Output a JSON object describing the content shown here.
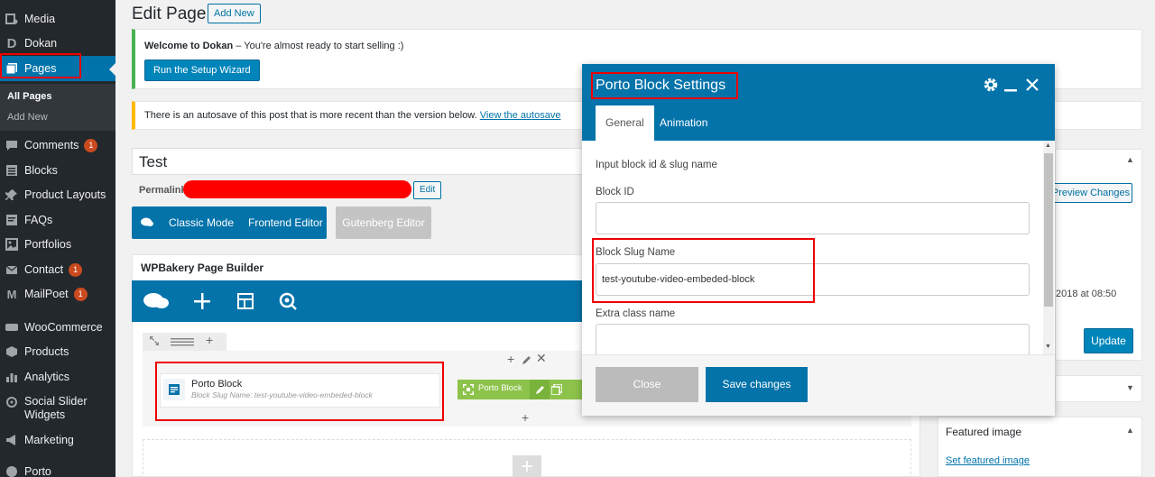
{
  "sidebar": {
    "items": [
      {
        "label": "Media",
        "icon": "media-icon",
        "badge": ""
      },
      {
        "label": "Dokan",
        "icon": "dokan-icon",
        "badge": ""
      },
      {
        "label": "Pages",
        "icon": "pages-icon",
        "badge": ""
      },
      {
        "label": "Comments",
        "icon": "comments-icon",
        "badge": "1"
      },
      {
        "label": "Blocks",
        "icon": "blocks-icon",
        "badge": ""
      },
      {
        "label": "Product Layouts",
        "icon": "pin-icon",
        "badge": ""
      },
      {
        "label": "FAQs",
        "icon": "faqs-icon",
        "badge": ""
      },
      {
        "label": "Portfolios",
        "icon": "portfolio-icon",
        "badge": ""
      },
      {
        "label": "Contact",
        "icon": "mail-icon",
        "badge": "1"
      },
      {
        "label": "MailPoet",
        "icon": "mailpoet-icon",
        "badge": "1"
      },
      {
        "label": "WooCommerce",
        "icon": "woo-icon",
        "badge": ""
      },
      {
        "label": "Products",
        "icon": "products-icon",
        "badge": ""
      },
      {
        "label": "Analytics",
        "icon": "analytics-icon",
        "badge": ""
      },
      {
        "label": "Social Slider",
        "label2": "Widgets",
        "icon": "social-icon",
        "badge": ""
      },
      {
        "label": "Marketing",
        "icon": "marketing-icon",
        "badge": ""
      },
      {
        "label": "Porto",
        "icon": "porto-icon",
        "badge": ""
      }
    ],
    "submenu": [
      "All Pages",
      "Add New"
    ]
  },
  "header": {
    "title": "Edit Page",
    "add_new": "Add New"
  },
  "notices": {
    "welcome_bold": "Welcome to Dokan",
    "welcome_rest": " – You're almost ready to start selling :)",
    "setup_button": "Run the Setup Wizard",
    "autosave_text": "There is an autosave of this post that is more recent than the version below. ",
    "autosave_link": "View the autosave"
  },
  "editor": {
    "title_value": "Test",
    "permalink_label": "Permalink:",
    "edit_label": "Edit",
    "classic_mode": "Classic Mode",
    "frontend_editor": "Frontend Editor",
    "gutenberg_editor": "Gutenberg Editor"
  },
  "builder": {
    "title": "WPBakery Page Builder",
    "element_title": "Porto Block",
    "element_subtitle": "Block Slug Name: test-youtube-video-embeded-block",
    "control_label": "Porto Block"
  },
  "right": {
    "preview_changes": "Preview Changes",
    "date_text": "2018 at 08:50",
    "update": "Update",
    "featured_title": "Featured image",
    "featured_link": "Set featured image"
  },
  "modal": {
    "title": "Porto Block Settings",
    "tabs": [
      "General",
      "Animation"
    ],
    "intro": "Input block id & slug name",
    "block_id_label": "Block ID",
    "block_id_value": "",
    "slug_label": "Block Slug Name",
    "slug_value": "test-youtube-video-embeded-block",
    "extra_class_label": "Extra class name",
    "extra_class_value": "",
    "close": "Close",
    "save": "Save changes"
  },
  "colors": {
    "accent": "#0473aa",
    "sidebar": "#23282d",
    "annotation": "#e00000",
    "green": "#8dc34a"
  }
}
